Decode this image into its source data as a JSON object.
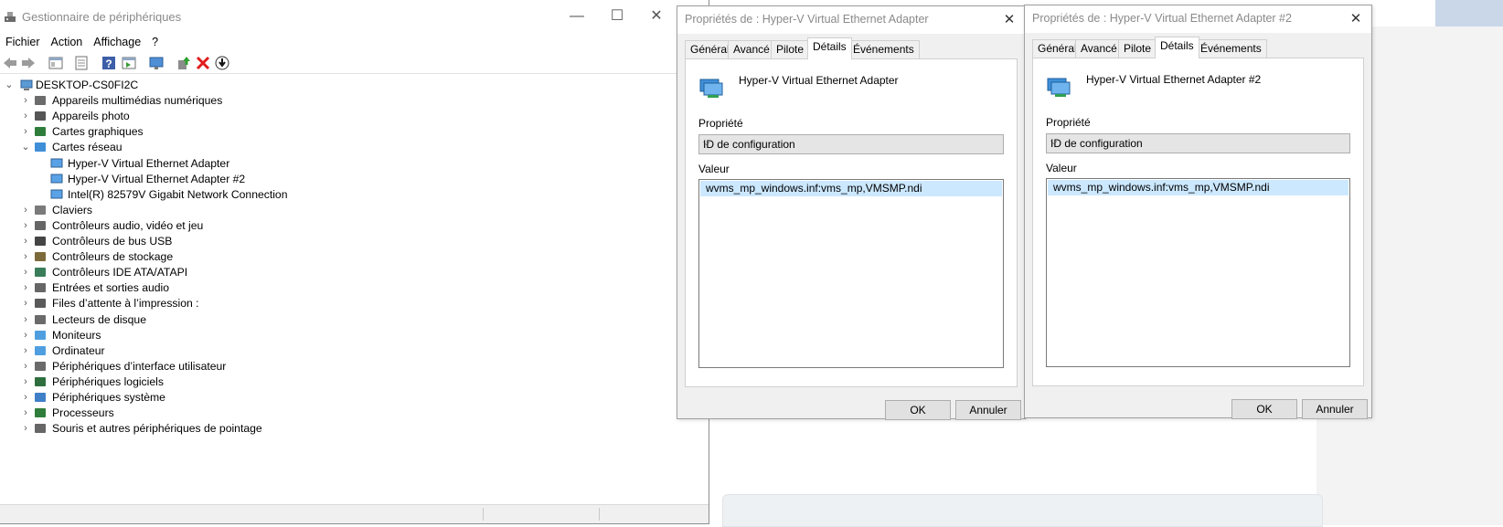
{
  "device_manager": {
    "title": "Gestionnaire de périphériques",
    "window_controls": {
      "minimize": "—",
      "maximize": "☐",
      "close": "✕"
    },
    "menu": [
      "Fichier",
      "Action",
      "Affichage",
      "?"
    ],
    "tree": {
      "root": "DESKTOP-CS0FI2C",
      "items": [
        {
          "label": "Appareils multimédias numériques",
          "expanded": false,
          "icon": "multimedia-icon"
        },
        {
          "label": "Appareils photo",
          "expanded": false,
          "icon": "camera-icon"
        },
        {
          "label": "Cartes graphiques",
          "expanded": false,
          "icon": "display-adapter-icon"
        },
        {
          "label": "Cartes réseau",
          "expanded": true,
          "icon": "network-adapter-icon",
          "children": [
            "Hyper-V Virtual Ethernet Adapter",
            "Hyper-V Virtual Ethernet Adapter #2",
            "Intel(R) 82579V Gigabit Network Connection"
          ]
        },
        {
          "label": "Claviers",
          "expanded": false,
          "icon": "keyboard-icon"
        },
        {
          "label": "Contrôleurs audio, vidéo et jeu",
          "expanded": false,
          "icon": "speaker-icon"
        },
        {
          "label": "Contrôleurs de bus USB",
          "expanded": false,
          "icon": "usb-icon"
        },
        {
          "label": "Contrôleurs de stockage",
          "expanded": false,
          "icon": "storage-controller-icon"
        },
        {
          "label": "Contrôleurs IDE ATA/ATAPI",
          "expanded": false,
          "icon": "ide-controller-icon"
        },
        {
          "label": "Entrées et sorties audio",
          "expanded": false,
          "icon": "audio-io-icon"
        },
        {
          "label": "Files d’attente à l’impression :",
          "expanded": false,
          "icon": "printer-icon"
        },
        {
          "label": "Lecteurs de disque",
          "expanded": false,
          "icon": "disk-drive-icon"
        },
        {
          "label": "Moniteurs",
          "expanded": false,
          "icon": "monitor-icon"
        },
        {
          "label": "Ordinateur",
          "expanded": false,
          "icon": "computer-icon"
        },
        {
          "label": "Périphériques d’interface utilisateur",
          "expanded": false,
          "icon": "hid-icon"
        },
        {
          "label": "Périphériques logiciels",
          "expanded": false,
          "icon": "software-device-icon"
        },
        {
          "label": "Périphériques système",
          "expanded": false,
          "icon": "system-device-icon"
        },
        {
          "label": "Processeurs",
          "expanded": false,
          "icon": "processor-icon"
        },
        {
          "label": "Souris et autres périphériques de pointage",
          "expanded": false,
          "icon": "mouse-icon"
        }
      ]
    }
  },
  "dialogs": [
    {
      "title": "Propriétés de : Hyper-V Virtual Ethernet Adapter",
      "tabs": [
        "Général",
        "Avancé",
        "Pilote",
        "Détails",
        "Événements"
      ],
      "active_tab": "Détails",
      "device_name": "Hyper-V Virtual Ethernet Adapter",
      "property_label": "Propriété",
      "property_value": "ID de configuration",
      "value_label": "Valeur",
      "value": "wvms_mp_windows.inf:vms_mp,VMSMP.ndi",
      "ok": "OK",
      "cancel": "Annuler"
    },
    {
      "title": "Propriétés de : Hyper-V Virtual Ethernet Adapter #2",
      "tabs": [
        "Général",
        "Avancé",
        "Pilote",
        "Détails",
        "Événements"
      ],
      "active_tab": "Détails",
      "device_name": "Hyper-V Virtual Ethernet Adapter #2",
      "property_label": "Propriété",
      "property_value": "ID de configuration",
      "value_label": "Valeur",
      "value": "wvms_mp_windows.inf:vms_mp,VMSMP.ndi",
      "ok": "OK",
      "cancel": "Annuler"
    }
  ],
  "colors": {
    "selection": "#cce8ff",
    "title_text": "#8a8a8a",
    "dialog_bg": "#f0f0f0"
  }
}
